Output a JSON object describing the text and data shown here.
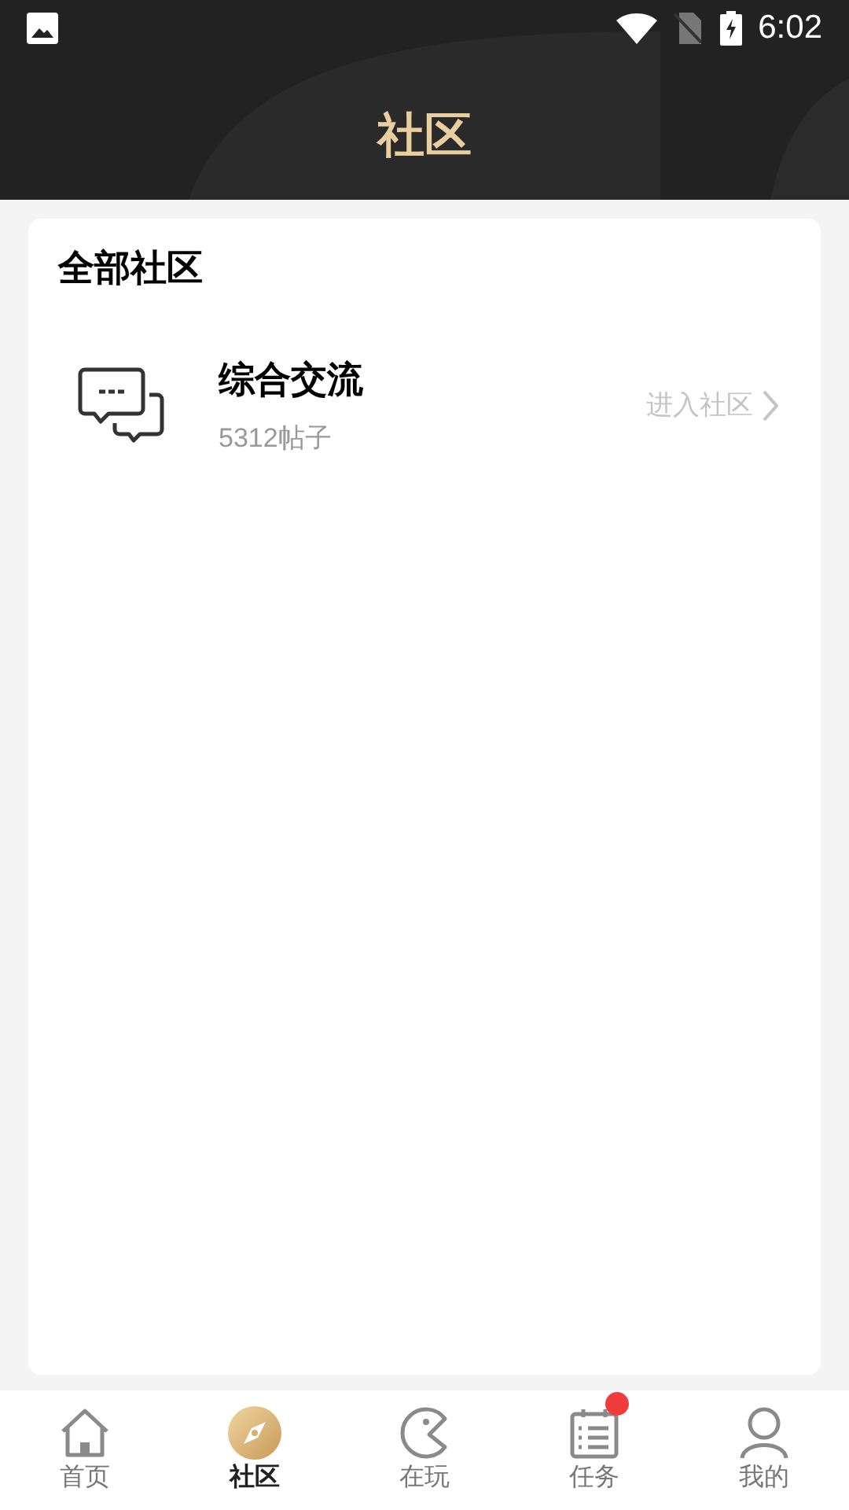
{
  "status_bar": {
    "time": "6:02"
  },
  "header": {
    "title": "社区"
  },
  "section": {
    "title": "全部社区",
    "communities": [
      {
        "name": "综合交流",
        "posts": "5312帖子",
        "action": "进入社区"
      }
    ]
  },
  "bottom_nav": [
    {
      "kind": "home",
      "label": "首页",
      "selected": false,
      "badge": false
    },
    {
      "kind": "compass",
      "label": "社区",
      "selected": true,
      "badge": false
    },
    {
      "kind": "play",
      "label": "在玩",
      "selected": false,
      "badge": false
    },
    {
      "kind": "tasks",
      "label": "任务",
      "selected": false,
      "badge": true
    },
    {
      "kind": "profile",
      "label": "我的",
      "selected": false,
      "badge": false
    }
  ]
}
